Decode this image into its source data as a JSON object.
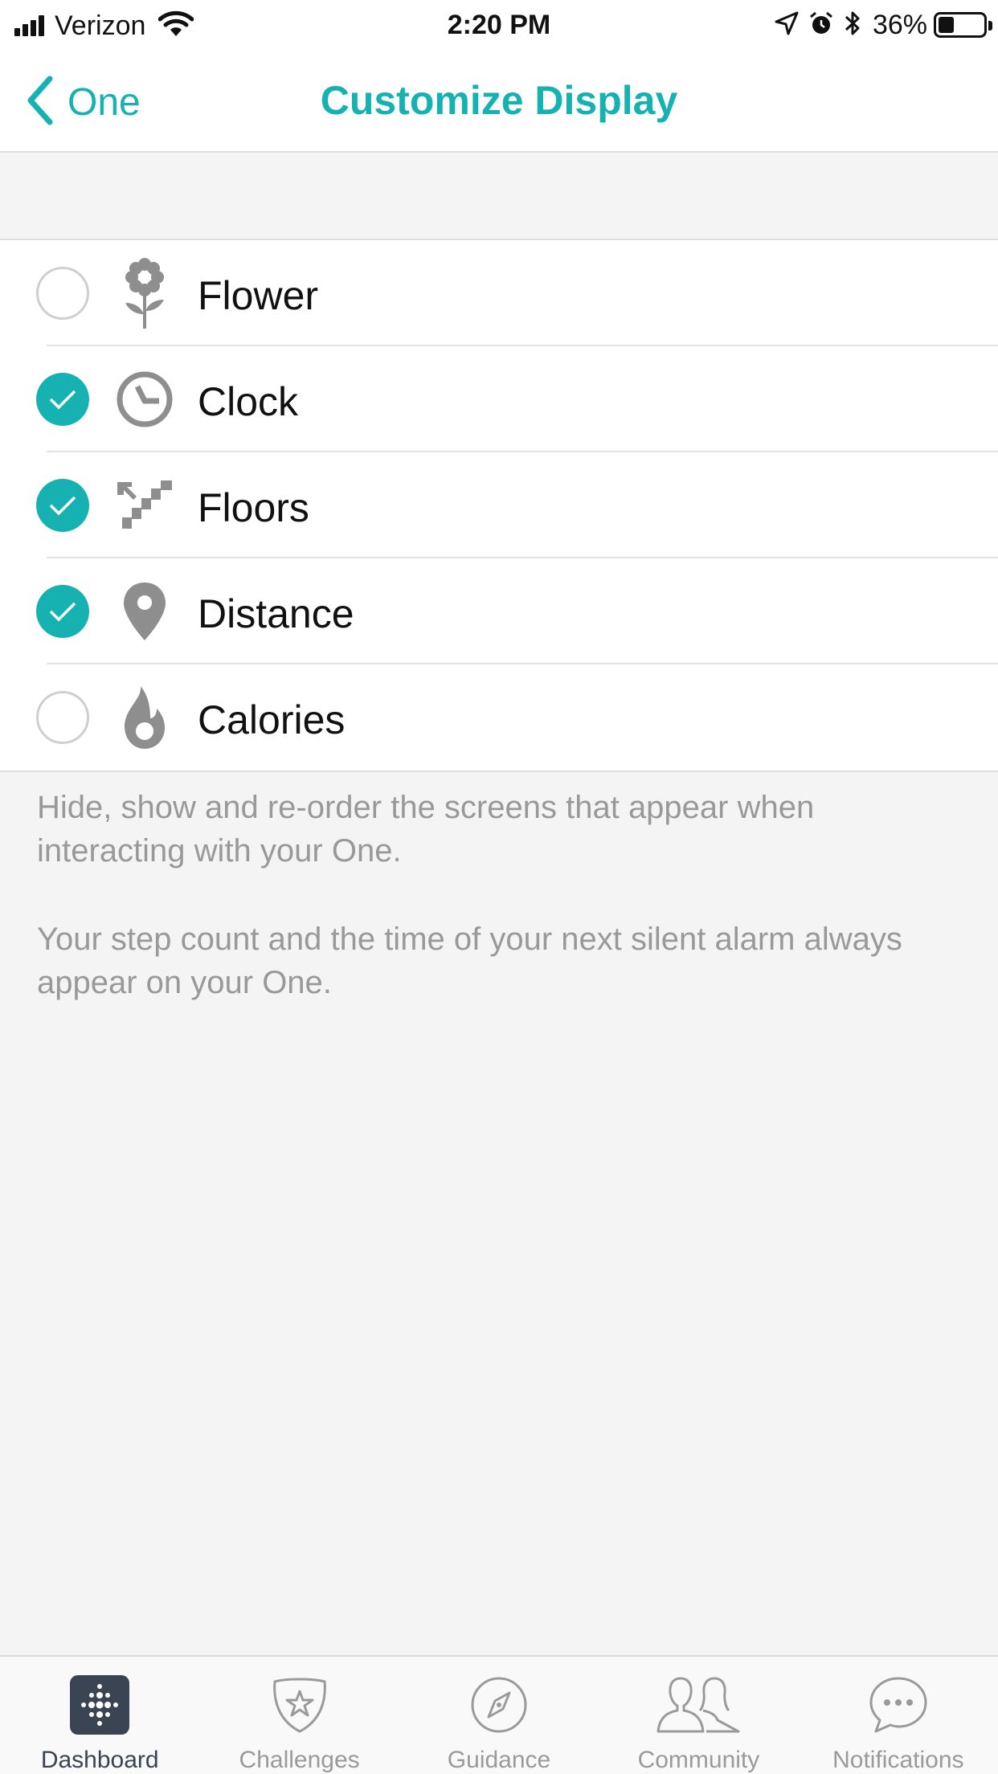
{
  "status_bar": {
    "carrier": "Verizon",
    "time": "2:20 PM",
    "battery_percent": "36%",
    "battery_level": 0.36,
    "icons": [
      "signal-icon",
      "wifi-icon",
      "location-icon",
      "alarm-icon",
      "bluetooth-icon",
      "battery-icon"
    ]
  },
  "nav": {
    "back_label": "One",
    "title": "Customize Display"
  },
  "list": {
    "items": [
      {
        "label": "Flower",
        "icon": "flower-icon",
        "checked": false
      },
      {
        "label": "Clock",
        "icon": "clock-icon",
        "checked": true
      },
      {
        "label": "Floors",
        "icon": "stairs-icon",
        "checked": true
      },
      {
        "label": "Distance",
        "icon": "map-pin-icon",
        "checked": true
      },
      {
        "label": "Calories",
        "icon": "flame-icon",
        "checked": false
      }
    ]
  },
  "footer": {
    "line1": "Hide, show and re-order the screens that appear when interacting with your One.",
    "line2": "Your step count and the time of your next silent alarm always appear on your One."
  },
  "tabs": [
    {
      "label": "Dashboard",
      "icon": "dashboard-icon",
      "active": true
    },
    {
      "label": "Challenges",
      "icon": "challenges-star-icon",
      "active": false
    },
    {
      "label": "Guidance",
      "icon": "compass-icon",
      "active": false
    },
    {
      "label": "Community",
      "icon": "people-icon",
      "active": false
    },
    {
      "label": "Notifications",
      "icon": "chat-bubble-icon",
      "active": false
    }
  ],
  "colors": {
    "accent": "#16b2b2",
    "icon_gray": "#8e8e8e",
    "text_secondary": "#999999",
    "tab_active": "#3b4452"
  }
}
